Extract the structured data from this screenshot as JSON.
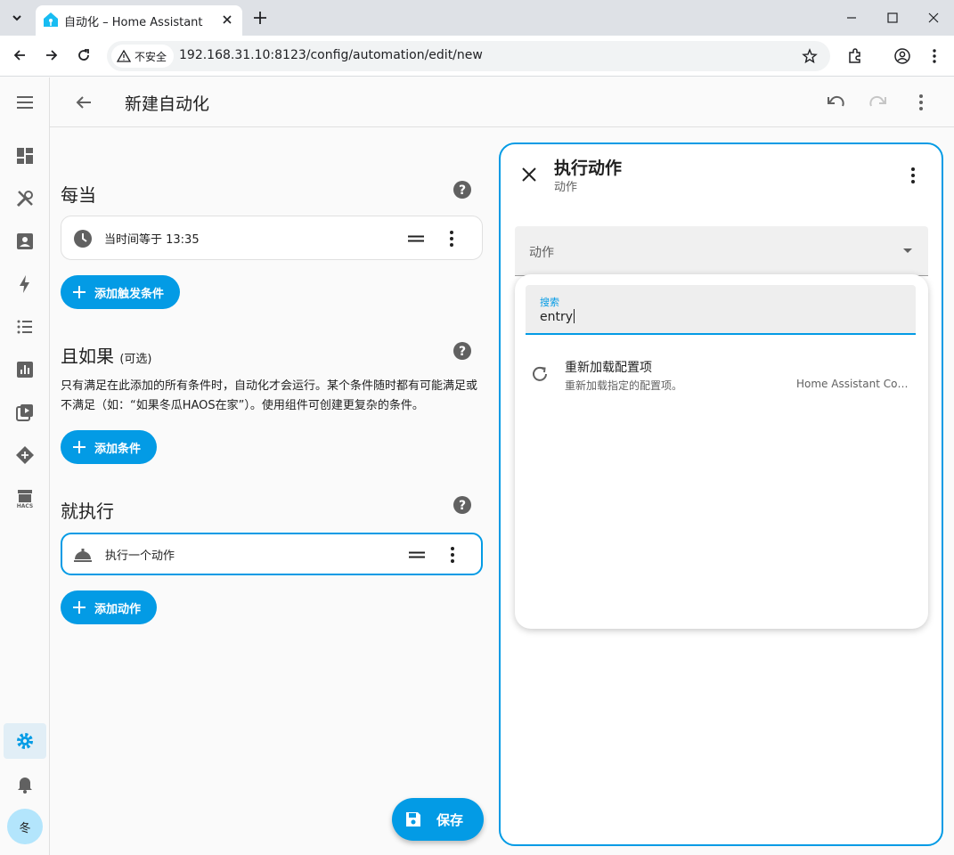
{
  "browser": {
    "tab_title": "自动化 – Home Assistant",
    "insecure_label": "不安全",
    "url": "192.168.31.10:8123/config/automation/edit/new"
  },
  "header": {
    "title": "新建自动化"
  },
  "sidebar": {
    "items": [
      "dashboard-icon",
      "tools-icon",
      "person-icon",
      "energy-icon",
      "list-icon",
      "chart-icon",
      "media-icon",
      "hacs-diamond-icon",
      "hacs-store-icon"
    ],
    "hacs_label": "HACS",
    "active": "settings",
    "avatar_initial": "冬"
  },
  "triggers": {
    "title": "每当",
    "items": [
      {
        "label": "当时间等于 13:35",
        "icon": "clock-icon"
      }
    ],
    "add_label": "添加触发条件"
  },
  "conditions": {
    "title": "且如果",
    "optional": "(可选)",
    "description": "只有满足在此添加的所有条件时，自动化才会运行。某个条件随时都有可能满足或不满足（如：“如果冬瓜HAOS在家”）。使用组件可创建更复杂的条件。",
    "add_label": "添加条件"
  },
  "actions": {
    "title": "就执行",
    "items": [
      {
        "label": "执行一个动作",
        "icon": "room-service-icon"
      }
    ],
    "add_label": "添加动作"
  },
  "save_label": "保存",
  "panel": {
    "title": "执行动作",
    "subtitle": "动作",
    "select_label": "动作",
    "search": {
      "label": "搜索",
      "value": "entry"
    },
    "results": [
      {
        "title": "重新加载配置项",
        "subtitle": "重新加载指定的配置项。",
        "meta": "Home Assistant Core Integration"
      }
    ]
  },
  "colors": {
    "accent": "#039be5",
    "panel_border": "#039be5"
  }
}
